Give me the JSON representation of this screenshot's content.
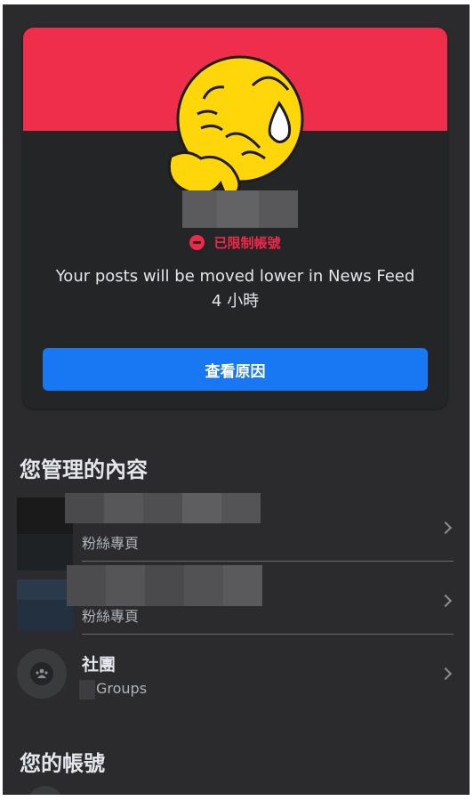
{
  "card": {
    "status_label": "已限制帳號",
    "message": "Your posts will be moved lower in News Feed",
    "duration": "4 小時",
    "button_label": "查看原因",
    "colors": {
      "banner": "#ee2e4a",
      "status": "#f02849",
      "button": "#1877f2"
    }
  },
  "managed": {
    "title": "您管理的內容",
    "items": [
      {
        "subtitle": "粉絲專頁"
      },
      {
        "subtitle": "粉絲專頁"
      },
      {
        "title": "社團",
        "subtitle": "Groups"
      }
    ]
  },
  "account": {
    "title": "您的帳號"
  },
  "icons": [
    "sad-emoji-icon",
    "minus-circle-icon",
    "chevron-right-icon",
    "groups-icon"
  ]
}
